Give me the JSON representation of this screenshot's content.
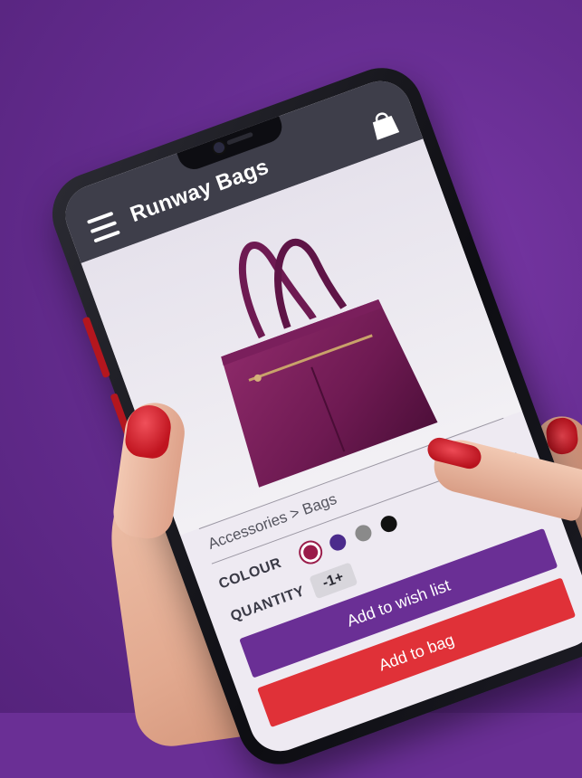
{
  "app": {
    "title": "Runway Bags"
  },
  "product": {
    "breadcrumb": "Accessories > Bags",
    "colour_label": "COLOUR",
    "colours": [
      {
        "name": "plum",
        "hex": "#9a1c4a",
        "selected": true
      },
      {
        "name": "purple",
        "hex": "#4b2b8c",
        "selected": false
      },
      {
        "name": "grey",
        "hex": "#8a8a8a",
        "selected": false
      },
      {
        "name": "black",
        "hex": "#111111",
        "selected": false
      }
    ],
    "quantity_label": "QUANTITY",
    "quantity_stepper": "-1+"
  },
  "actions": {
    "wish_list": "Add to wish list",
    "add_to_bag": "Add to bag"
  },
  "theme": {
    "background": "#662d91",
    "appbar": "#3e3e4a",
    "wish_button": "#6a2f95",
    "bag_button": "#e03138"
  },
  "icons": {
    "menu": "hamburger-menu-icon",
    "cart": "shopping-bag-icon"
  }
}
